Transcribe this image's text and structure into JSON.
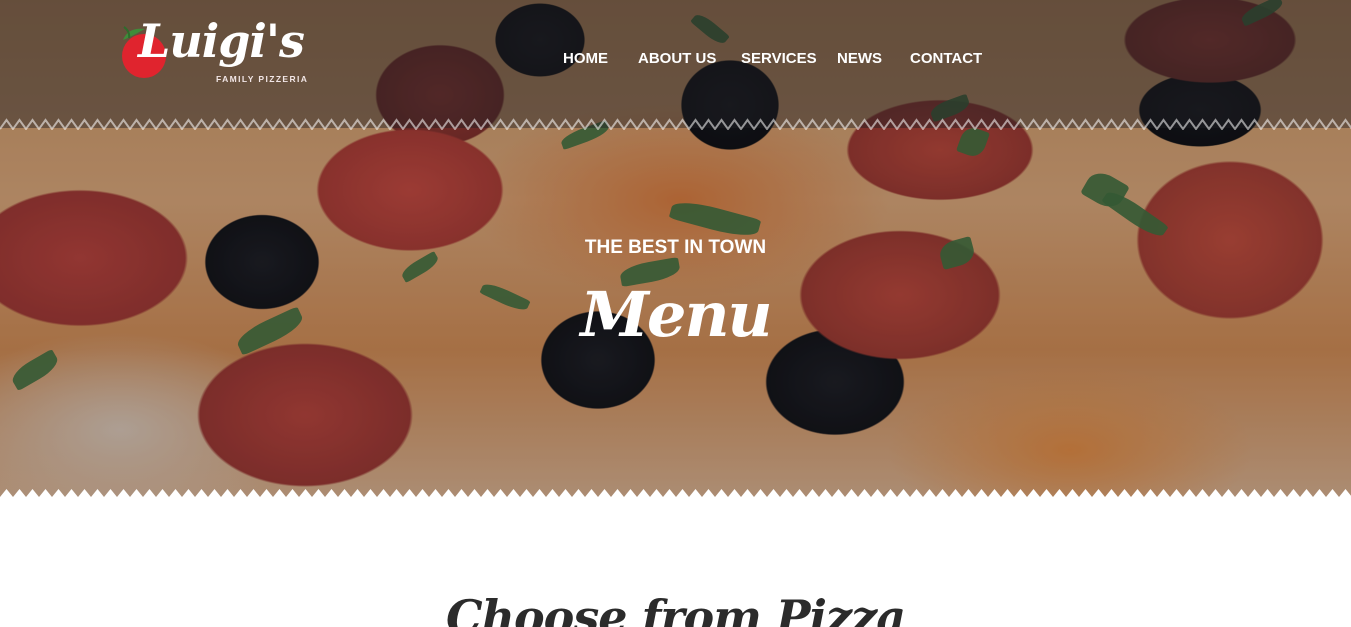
{
  "brand": {
    "name": "Luigi's",
    "subtitle": "FAMILY PIZZERIA",
    "accent_color": "#e0242e",
    "leaf_color": "#3f8c3a"
  },
  "nav": {
    "items": [
      {
        "label": "HOME"
      },
      {
        "label": "ABOUT US"
      },
      {
        "label": "SERVICES"
      },
      {
        "label": "NEWS"
      },
      {
        "label": "CONTACT"
      }
    ]
  },
  "hero": {
    "tagline": "THE BEST IN TOWN",
    "title": "Menu"
  },
  "content": {
    "section_title": "Choose from Pizza"
  }
}
